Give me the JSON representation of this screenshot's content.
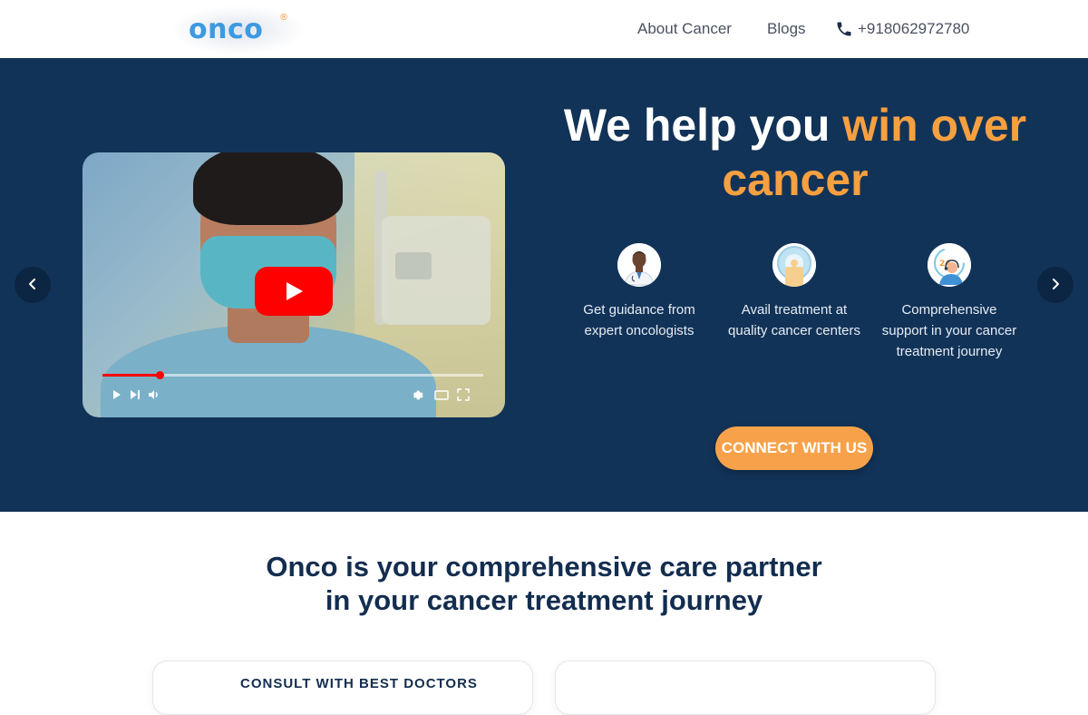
{
  "header": {
    "logo_text": "onco",
    "logo_mark": "®",
    "nav": {
      "about": "About Cancer",
      "blogs": "Blogs",
      "phone": "+918062972780"
    }
  },
  "hero": {
    "headline_prefix": "We help you ",
    "headline_accent": "win over cancer",
    "features": [
      {
        "icon": "doctor-icon",
        "text": "Get guidance from expert oncologists"
      },
      {
        "icon": "scanner-icon",
        "text": "Avail treatment at quality cancer centers"
      },
      {
        "icon": "support-24-icon",
        "text": "Comprehensive support in your cancer treatment journey"
      }
    ],
    "cta_label": "CONNECT WITH US",
    "video": {
      "progress": 0.15
    }
  },
  "section": {
    "title_line1": "Onco is your comprehensive care partner",
    "title_line2": "in your cancer treatment journey"
  },
  "cards": [
    {
      "label": "CONSULT WITH BEST DOCTORS"
    },
    {
      "label": ""
    }
  ],
  "colors": {
    "hero_bg": "#123358",
    "accent": "#f7a040",
    "logo_blue": "#3d9ae0",
    "title_navy": "#132d4f",
    "youtube_red": "#ff0000"
  }
}
